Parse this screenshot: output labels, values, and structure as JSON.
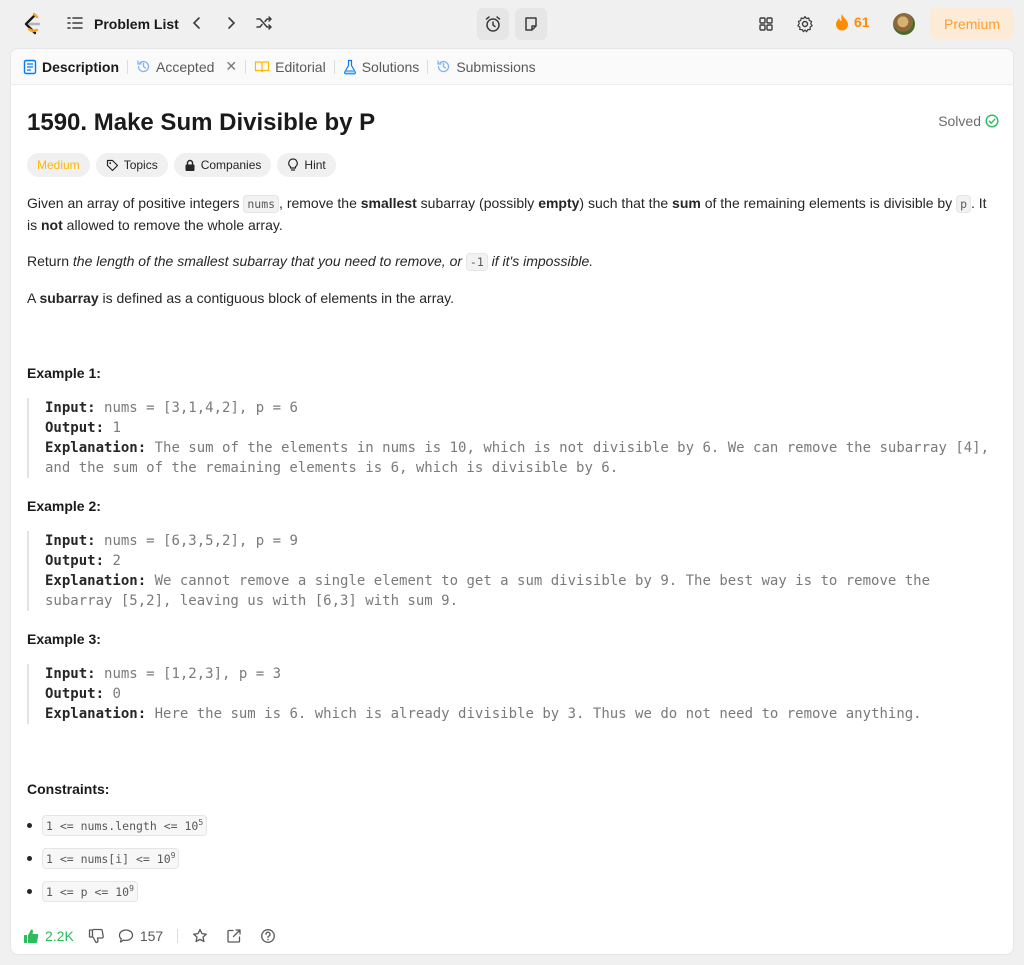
{
  "header": {
    "problem_list_label": "Problem List",
    "streak_count": "61",
    "premium_label": "Premium"
  },
  "tabs": [
    {
      "label": "Description",
      "icon": "description-icon"
    },
    {
      "label": "Accepted",
      "icon": "history-icon"
    },
    {
      "label": "Editorial",
      "icon": "book-icon"
    },
    {
      "label": "Solutions",
      "icon": "flask-icon"
    },
    {
      "label": "Submissions",
      "icon": "history-icon"
    }
  ],
  "problem": {
    "title": "1590. Make Sum Divisible by P",
    "status": "Solved",
    "difficulty": "Medium",
    "tags": [
      "Topics",
      "Companies",
      "Hint"
    ],
    "desc": {
      "p1_a": "Given an array of positive integers ",
      "p1_code1": "nums",
      "p1_b": ", remove the ",
      "p1_bold1": "smallest",
      "p1_c": " subarray (possibly ",
      "p1_bold2": "empty",
      "p1_d": ") such that the ",
      "p1_bold3": "sum",
      "p1_e": " of the remaining elements is divisible by ",
      "p1_code2": "p",
      "p1_f": ". It is ",
      "p1_bold4": "not",
      "p1_g": " allowed to remove the whole array.",
      "p2_a": "Return ",
      "p2_italic1": "the length of the smallest subarray that you need to remove, or ",
      "p2_code": "-1",
      "p2_italic2": " if it's impossible.",
      "p3_a": "A ",
      "p3_bold": "subarray",
      "p3_b": " is defined as a contiguous block of elements in the array."
    },
    "examples": [
      {
        "title": "Example 1:",
        "input_label": "Input:",
        "input": "nums = [3,1,4,2], p = 6",
        "output_label": "Output:",
        "output": "1",
        "explanation_label": "Explanation:",
        "explanation_line1": "The sum of the elements in nums is 10, which is not divisible by 6. We can remove the subarray [4],",
        "explanation_line2": "and the sum of the remaining elements is 6, which is divisible by 6."
      },
      {
        "title": "Example 2:",
        "input_label": "Input:",
        "input": "nums = [6,3,5,2], p = 9",
        "output_label": "Output:",
        "output": "2",
        "explanation_label": "Explanation:",
        "explanation_line1": "We cannot remove a single element to get a sum divisible by 9. The best way is to remove the",
        "explanation_line2": "subarray [5,2], leaving us with [6,3] with sum 9."
      },
      {
        "title": "Example 3:",
        "input_label": "Input:",
        "input": "nums = [1,2,3], p = 3",
        "output_label": "Output:",
        "output": "0",
        "explanation_label": "Explanation:",
        "explanation_line1": "Here the sum is 6. which is already divisible by 3. Thus we do not need to remove anything.",
        "explanation_line2": ""
      }
    ],
    "constraints_title": "Constraints:",
    "constraints": [
      {
        "code": "1 <= nums.length <= 10",
        "sup": "5"
      },
      {
        "code": "1 <= nums[i] <= 10",
        "sup": "9"
      },
      {
        "code": "1 <= p <= 10",
        "sup": "9"
      }
    ]
  },
  "footer": {
    "likes": "2.2K",
    "comments": "157"
  },
  "colors": {
    "accent_orange": "#ffa116",
    "easy_green": "#2cbb5d",
    "medium_yellow": "#ffb800",
    "link_blue": "#007aff"
  }
}
